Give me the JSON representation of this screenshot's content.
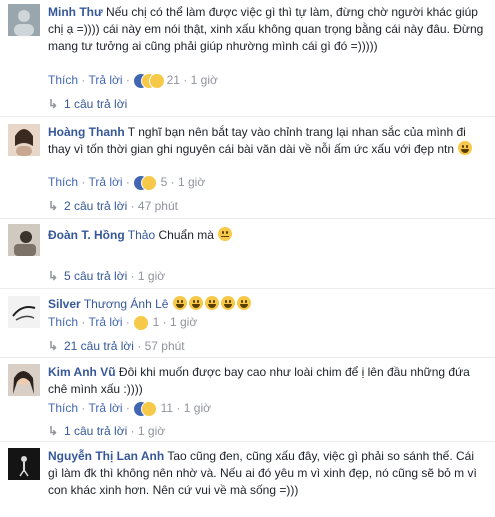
{
  "actions": {
    "like": "Thích",
    "reply": "Trả lời"
  },
  "comments": [
    {
      "author": "Minh Thư",
      "text": "Nếu chị có thể làm được việc gì thì tự làm, đừng chờ người khác giúp chị ạ =)))) cái này em nói thật, xinh xấu không quan trọng bằng cái này đâu. Đừng mang tư tưởng ai cũng phải giúp nhường mình cái gì đó =)))))",
      "reaction_count": "21",
      "time": "1 giờ",
      "replies": "1 câu trả lời",
      "reply_time": ""
    },
    {
      "author": "Hoàng Thanh",
      "text": "T nghĩ bạn nên bắt tay vào chỉnh trang lại nhan sắc của mình đi thay vì tốn thời gian ghi nguyên cái bài văn dài về nỗi ấm ức xấu với đẹp ntn",
      "reaction_count": "5",
      "time": "1 giờ",
      "replies": "2 câu trả lời",
      "reply_time": "47 phút"
    },
    {
      "author": "Đoàn T. Hồng",
      "tag": "Thảo",
      "text": "Chuẩn mà",
      "reaction_count": "",
      "time": "",
      "replies": "5 câu trả lời",
      "reply_time": "1 giờ"
    },
    {
      "author": "Silver",
      "tag": "Thương Ánh Lê",
      "text": "",
      "reaction_count": "1",
      "time": "1 giờ",
      "replies": "21 câu trả lời",
      "reply_time": "57 phút"
    },
    {
      "author": "Kim Anh Vũ",
      "text": "Đôi khi muốn được bay cao như loài chim để ị lên đầu những đứa chê mình xấu :))))",
      "reaction_count": "11",
      "time": "1 giờ",
      "replies": "1 câu trả lời",
      "reply_time": "1 giờ"
    },
    {
      "author": "Nguyễn Thị Lan Anh",
      "text": "Tao cũng đen, cũng xấu đây, việc gì phải so sánh thế. Cái gì làm đk thì không nên nhờ và. Nếu ai đó yêu m vì xinh đẹp, nó cũng sẽ bỏ m vì con khác xinh hơn. Nên cứ vui về mà sống =)))"
    }
  ]
}
